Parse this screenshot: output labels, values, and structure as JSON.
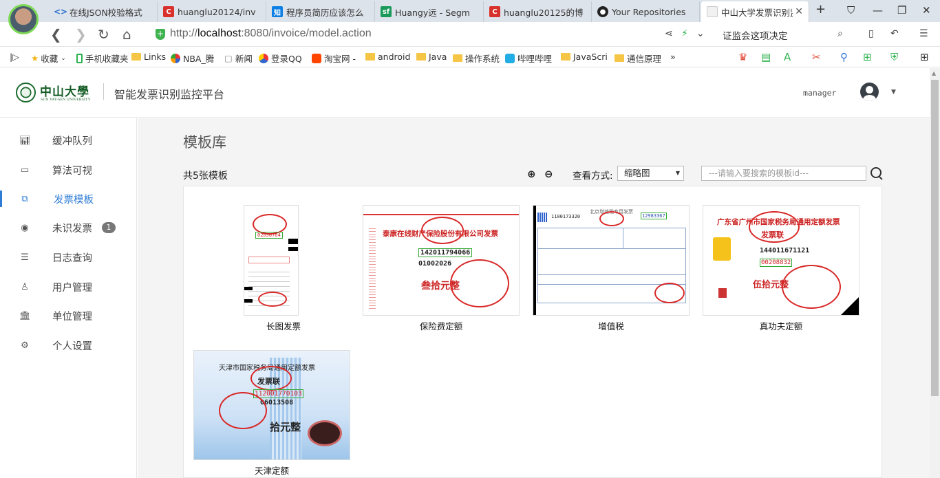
{
  "browser": {
    "tabs": [
      {
        "label": "在线JSON校验格式",
        "fav": "json"
      },
      {
        "label": "huanglu20124/inv",
        "fav": "csdn"
      },
      {
        "label": "程序员简历应该怎么",
        "fav": "zhihu"
      },
      {
        "label": "Huangy远 - Segm",
        "fav": "sf"
      },
      {
        "label": "huanglu20125的博",
        "fav": "csdn"
      },
      {
        "label": "Your Repositories",
        "fav": "github"
      },
      {
        "label": "中山大学发票识别监",
        "fav": "page"
      }
    ],
    "url_prefix": "http://",
    "url_host": "localhost",
    "url_rest": ":8080/invoice/model.action",
    "search_text": "证监会这项决定",
    "bookmarks": [
      "收藏",
      "手机收藏夹",
      "Links",
      "NBA_腾",
      "新闻",
      "登录QQ",
      "淘宝网 -",
      "android",
      "Java",
      "操作系统",
      "哔哩哔哩",
      "JavaScri",
      "通信原理"
    ],
    "more": "»"
  },
  "header": {
    "logo_cn": "中山大學",
    "logo_en": "SUN YAT-SEN UNIVERSITY",
    "platform_title": "智能发票识别监控平台",
    "username": "manager"
  },
  "sidebar": {
    "items": [
      {
        "label": "缓冲队列",
        "icon": "bar-chart-icon"
      },
      {
        "label": "算法可视",
        "icon": "monitor-icon"
      },
      {
        "label": "发票模板",
        "icon": "copy-icon",
        "active": true
      },
      {
        "label": "未识发票",
        "icon": "circle-dot-icon",
        "badge": "1"
      },
      {
        "label": "日志查询",
        "icon": "list-icon"
      },
      {
        "label": "用户管理",
        "icon": "user-icon"
      },
      {
        "label": "单位管理",
        "icon": "bank-icon"
      },
      {
        "label": "个人设置",
        "icon": "gear-icon"
      }
    ]
  },
  "main": {
    "title": "模板库",
    "count": "共5张模板",
    "view_label": "查看方式:",
    "view_value": "缩略图",
    "search_placeholder": "---请输入要搜索的模板id---",
    "templates": [
      {
        "caption": "长图发票",
        "text": [
          "02050764"
        ]
      },
      {
        "caption": "保险费定额",
        "text": [
          "泰康在线财产保险股份有限公司发票",
          "142011794066",
          "01002026",
          "叁拾元整"
        ]
      },
      {
        "caption": "增值税",
        "text": [
          "1100173320",
          "北京增值税专用发票",
          "12983367"
        ]
      },
      {
        "caption": "真功夫定额",
        "text": [
          "广东省广州市国家税务局通用定额发票",
          "发票联",
          "144011671121",
          "00208832",
          "伍拾元整"
        ]
      },
      {
        "caption": "天津定额",
        "text": [
          "天津市国家税务局通用定额发票",
          "发票联",
          "112001770103",
          "06013508",
          "拾元整"
        ]
      }
    ]
  },
  "colors": {
    "accent": "#2e7cd6",
    "stamp": "#d92727",
    "brand_green": "#145c26"
  }
}
